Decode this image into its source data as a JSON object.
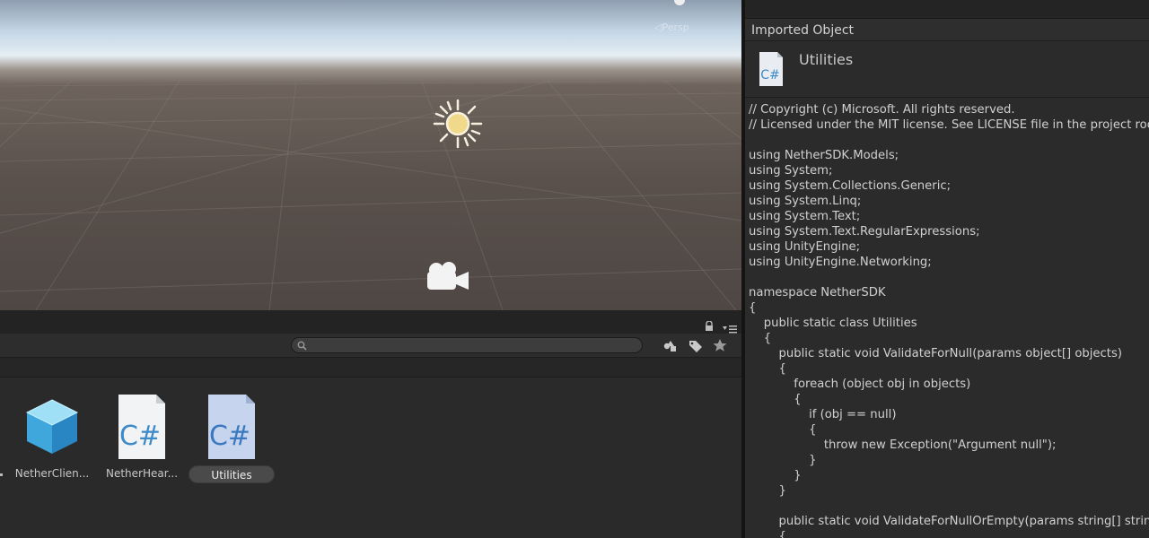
{
  "scene_view": {
    "projection_label": "◁Persp",
    "icons": [
      "sun-icon",
      "camera-icon"
    ]
  },
  "project_panel": {
    "search": {
      "value": "",
      "placeholder": ""
    },
    "toolbar_icons": [
      "filter-by-type-icon",
      "filter-by-label-icon",
      "favorite-star-icon"
    ],
    "assets": [
      {
        "label": "NetherClien...",
        "icon": "prefab-cube-icon"
      },
      {
        "label": "NetherHear...",
        "icon": "csharp-script-icon"
      },
      {
        "label": "Utilities",
        "icon": "csharp-script-icon",
        "selected": true
      }
    ]
  },
  "inspector": {
    "title": "Imported Object",
    "asset_name": "Utilities",
    "asset_icon": "csharp-script-icon",
    "code": "// Copyright (c) Microsoft. All rights reserved.\n// Licensed under the MIT license. See LICENSE file in the project root for full license information.\n\nusing NetherSDK.Models;\nusing System;\nusing System.Collections.Generic;\nusing System.Linq;\nusing System.Text;\nusing System.Text.RegularExpressions;\nusing UnityEngine;\nusing UnityEngine.Networking;\n\nnamespace NetherSDK\n{\n    public static class Utilities\n    {\n        public static void ValidateForNull(params object[] objects)\n        {\n            foreach (object obj in objects)\n            {\n                if (obj == null)\n                {\n                    throw new Exception(\"Argument null\");\n                }\n            }\n        }\n\n        public static void ValidateForNullOrEmpty(params string[] strings)\n        {"
  },
  "colors": {
    "selection_pill": "#4a4a4a",
    "panel_background": "#2a2a2a",
    "code_text": "#d0d0d0"
  }
}
